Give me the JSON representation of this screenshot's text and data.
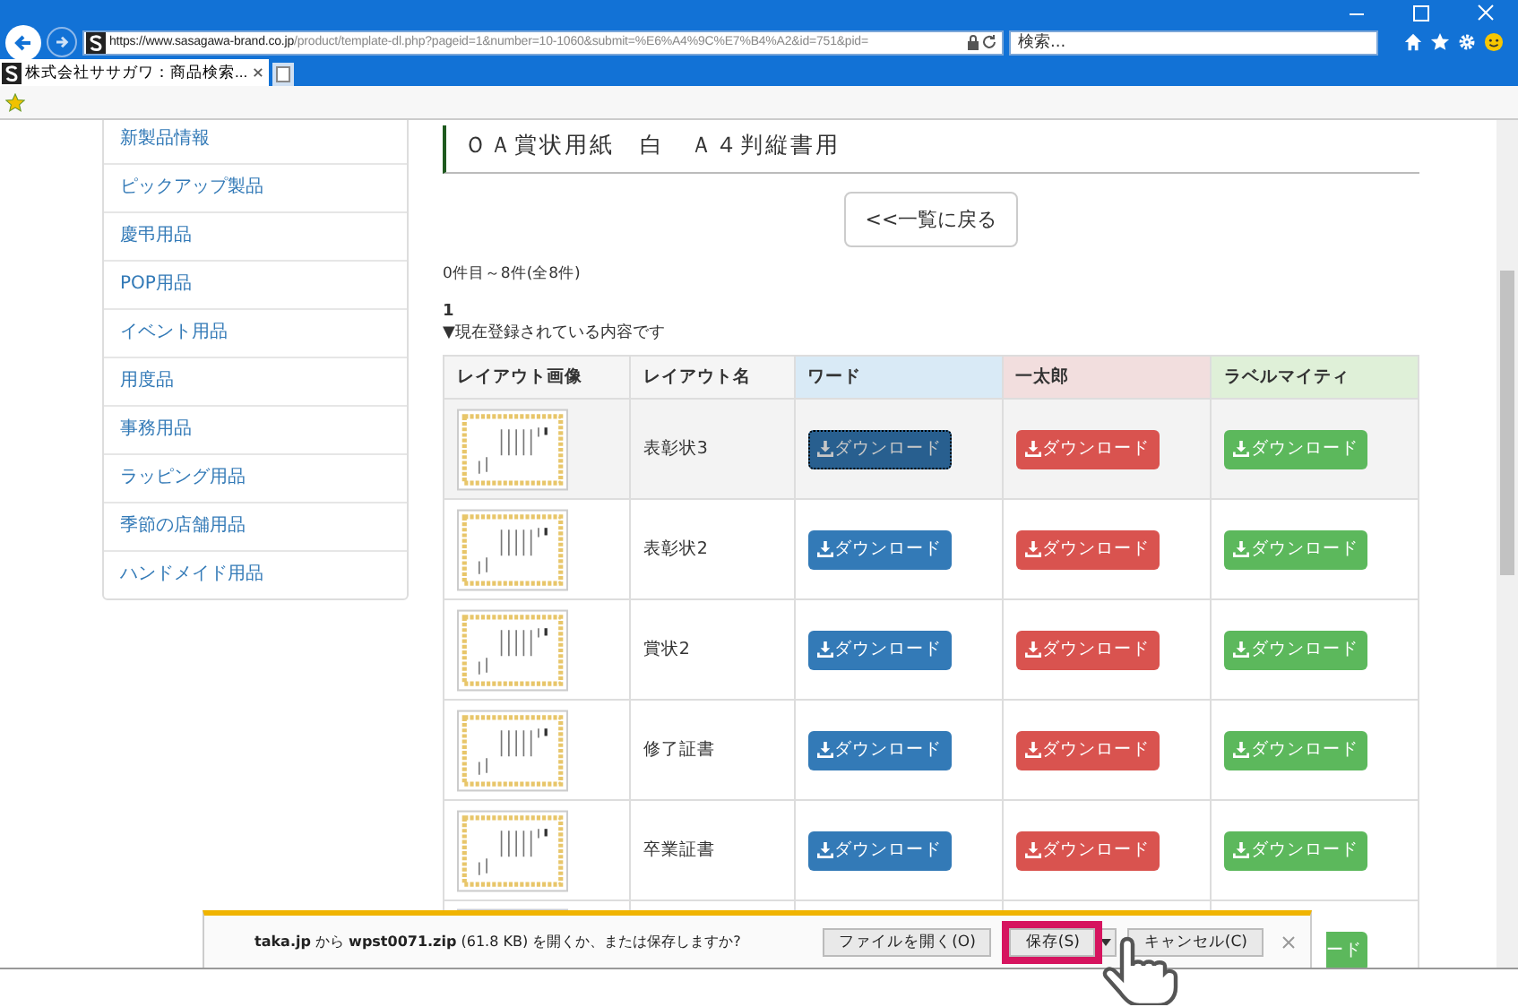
{
  "browser": {
    "address_host": "https://www.sasagawa-brand.co.jp",
    "address_path": "/product/template-dl.php?pageid=1&number=10-1060&submit=%E6%A4%9C%E7%B4%A2&id=751&pid=",
    "search": {
      "placeholder": "検索..."
    },
    "tab": {
      "title": "株式会社ササガワ：商品検索..."
    }
  },
  "sidebar": {
    "items": [
      "新製品情報",
      "ピックアップ製品",
      "慶弔用品",
      "POP用品",
      "イベント用品",
      "用度品",
      "事務用品",
      "ラッピング用品",
      "季節の店舗用品",
      "ハンドメイド用品"
    ]
  },
  "title": "ＯＡ賞状用紙　白　Ａ４判縦書用",
  "back_button": "<<一覧に戻る",
  "count": "0件目～8件(全8件)",
  "page": "1",
  "note": "▼現在登録されている内容です",
  "table": {
    "columns": [
      {
        "label": "レイアウト画像",
        "color": "#f5f5f5"
      },
      {
        "label": "レイアウト名",
        "color": "#f5f5f5"
      },
      {
        "label": "ワード",
        "color": "#d9eaf6"
      },
      {
        "label": "一太郎",
        "color": "#f2dede"
      },
      {
        "label": "ラベルマイティ",
        "color": "#dff0d8"
      }
    ],
    "rows": [
      {
        "kind": "full",
        "name": "表彰状3",
        "selected": true,
        "downloads": [
          "ダウンロード",
          "ダウンロード",
          "ダウンロード"
        ]
      },
      {
        "kind": "full",
        "name": "表彰状2",
        "selected": false,
        "downloads": [
          "ダウンロード",
          "ダウンロード",
          "ダウンロード"
        ]
      },
      {
        "kind": "full",
        "name": "賞状2",
        "selected": false,
        "downloads": [
          "ダウンロード",
          "ダウンロード",
          "ダウンロード"
        ]
      },
      {
        "kind": "full",
        "name": "修了証書",
        "selected": false,
        "downloads": [
          "ダウンロード",
          "ダウンロード",
          "ダウンロード"
        ]
      },
      {
        "kind": "full",
        "name": "卒業証書",
        "selected": false,
        "downloads": [
          "ダウンロード",
          "ダウンロード",
          "ダウンロード"
        ]
      },
      {
        "kind": "partial",
        "selected": false,
        "downloads": [
          "ード"
        ]
      }
    ]
  },
  "download_bar": {
    "message": "**taka.jp** から **wpst0071.zip** (61.8 KB) を開くか、または保存しますか?",
    "buttons": [
      {
        "label": "ファイルを開く(O)",
        "highlighted": false
      },
      {
        "label": "保存(S)",
        "highlighted": true
      },
      {
        "label": "キャンセル(C)",
        "highlighted": false
      }
    ]
  }
}
